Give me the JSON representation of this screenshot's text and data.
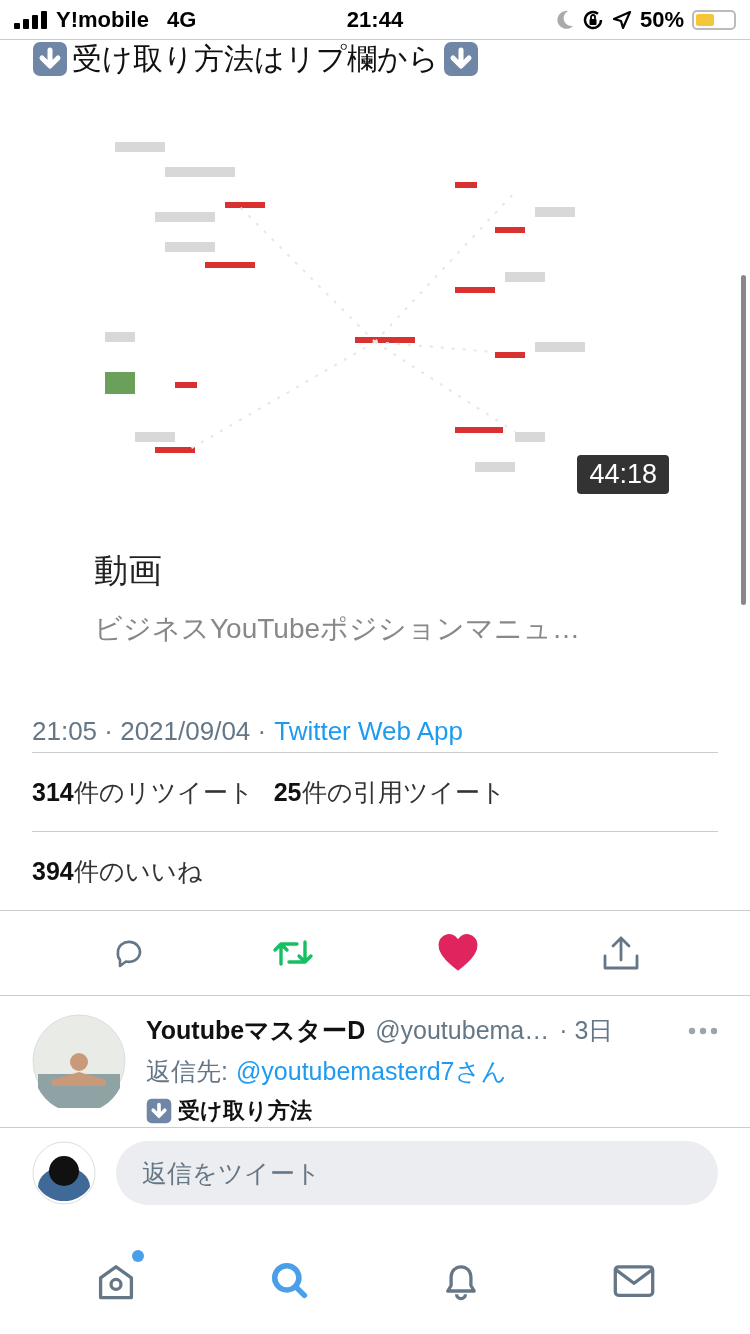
{
  "status_bar": {
    "carrier": "Y!mobile",
    "network": "4G",
    "time": "21:44",
    "battery": "50%"
  },
  "tweet": {
    "headline": "受け取り方法はリプ欄から",
    "media": {
      "kind": "picture",
      "duration": "44:18",
      "title": "動画",
      "subtitle": "ビジネスYouTubeポジションマニュ…"
    },
    "timestamp": "21:05 · 2021/09/04 ·",
    "source": "Twitter Web App",
    "stats": [
      {
        "count": "314",
        "label": "件のリツイート"
      },
      {
        "count": "25",
        "label": "件の引用ツイート"
      }
    ],
    "likes": {
      "count": "394",
      "label": "件のいいね"
    },
    "actions": [
      {
        "kind": "reply",
        "active": false
      },
      {
        "kind": "retweet",
        "active": true
      },
      {
        "kind": "like",
        "active": true
      },
      {
        "kind": "share",
        "active": false
      }
    ]
  },
  "reply": {
    "name": "YoutubeマスターD",
    "handle": "@youtubema…",
    "age": "· 3日",
    "reply_to_label": "返信先:",
    "reply_to": "@youtubemasterd7さん",
    "text": "受け取り方法"
  },
  "composer": {
    "placeholder": "返信をツイート"
  },
  "tabs": [
    {
      "kind": "home",
      "selected": false,
      "badge": true
    },
    {
      "kind": "search",
      "selected": true,
      "badge": false
    },
    {
      "kind": "notifications",
      "selected": false,
      "badge": false
    },
    {
      "kind": "messages",
      "selected": false,
      "badge": false
    }
  ]
}
